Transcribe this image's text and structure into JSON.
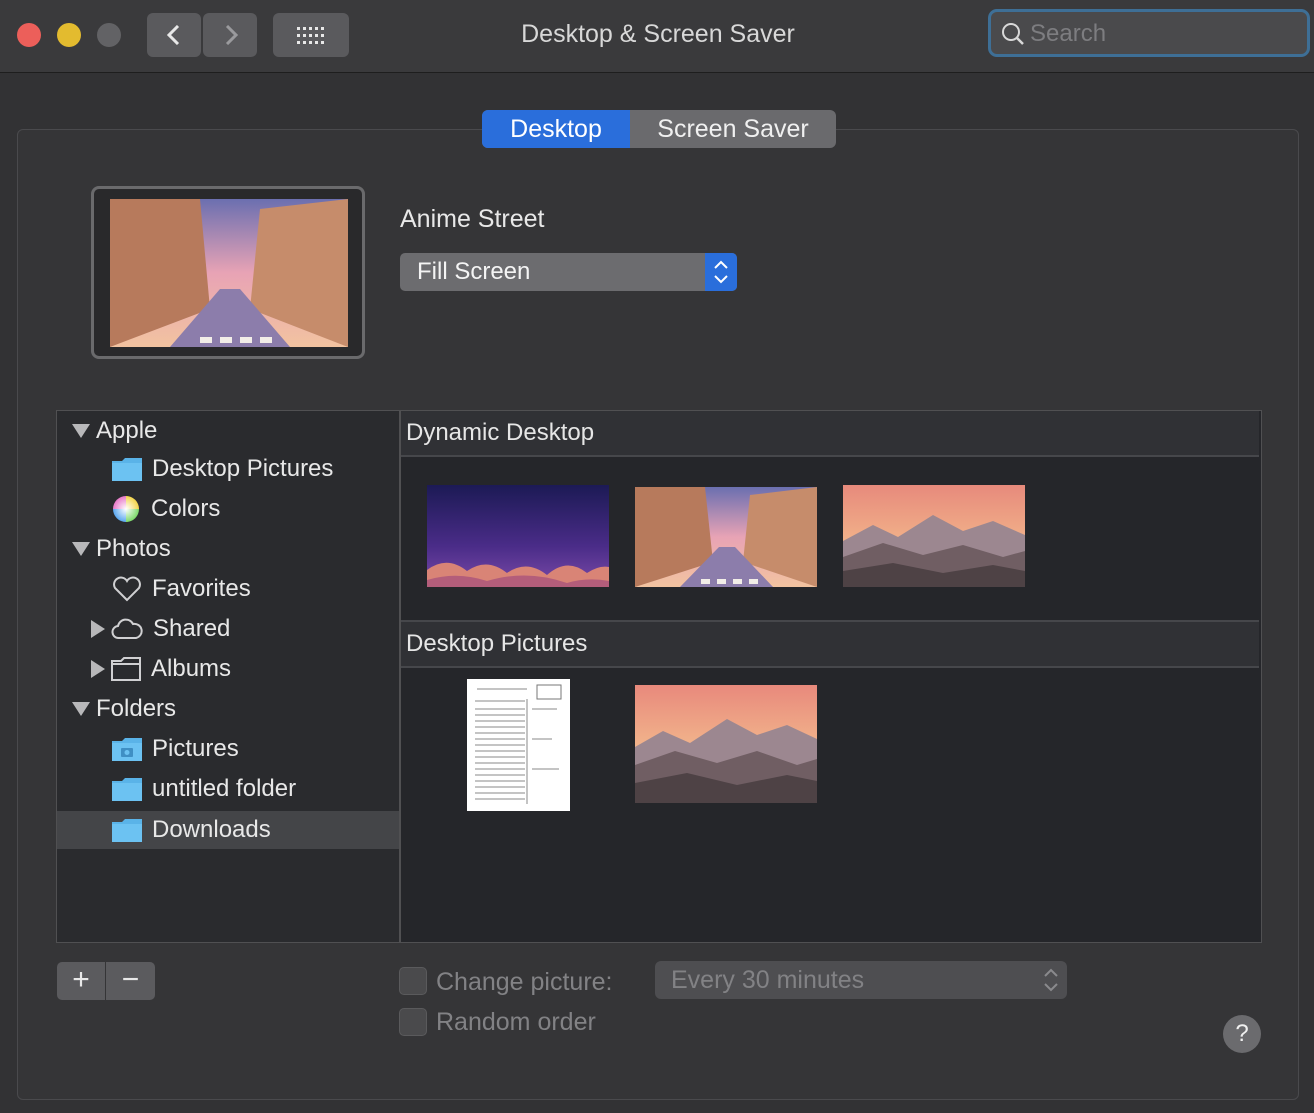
{
  "window": {
    "title": "Desktop & Screen Saver"
  },
  "search": {
    "placeholder": "Search"
  },
  "tabs": [
    {
      "label": "Desktop",
      "selected": true
    },
    {
      "label": "Screen Saver",
      "selected": false
    }
  ],
  "current": {
    "name": "Anime Street",
    "mode_value": "Fill Screen"
  },
  "sidebar": {
    "groups": [
      {
        "label": "Apple",
        "items": [
          "Desktop Pictures",
          "Colors"
        ]
      },
      {
        "label": "Photos",
        "items": [
          "Favorites",
          "Shared",
          "Albums"
        ]
      },
      {
        "label": "Folders",
        "items": [
          "Pictures",
          "untitled folder",
          "Downloads"
        ]
      }
    ],
    "selected": "Downloads"
  },
  "gallery": {
    "sections": [
      {
        "title": "Dynamic Desktop",
        "thumbs": [
          "dusk-dunes-thumb",
          "anime-street-thumb",
          "pink-mountains-thumb"
        ]
      },
      {
        "title": "Desktop Pictures",
        "thumbs": [
          "document-thumb",
          "mountains-thumb"
        ]
      }
    ]
  },
  "options": {
    "change_picture_label": "Change picture:",
    "interval_value": "Every 30 minutes",
    "random_label": "Random order",
    "change_checked": false,
    "random_checked": false
  },
  "buttons": {
    "add": "+",
    "remove": "−",
    "help": "?"
  },
  "colors": {
    "accent": "#2a6edb",
    "background": "#323234",
    "sidebar": "#2a2b2e",
    "selected_row": "#444548"
  }
}
